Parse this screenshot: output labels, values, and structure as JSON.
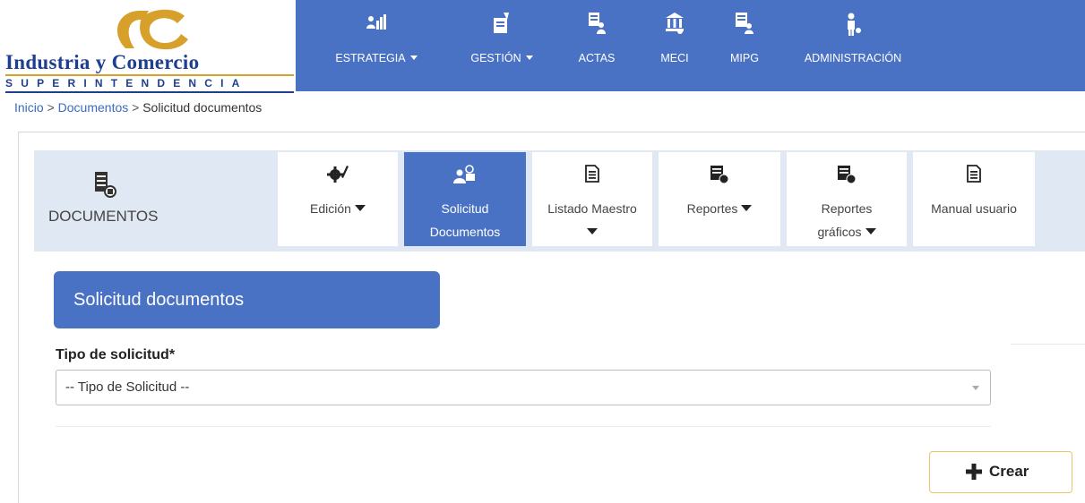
{
  "logo": {
    "line1": "Industria y Comercio",
    "line2": "SUPERINTENDENCIA"
  },
  "topnav": {
    "items": [
      {
        "label": "ESTRATEGIA",
        "icon": "people-chart-icon",
        "dropdown": true
      },
      {
        "label": "GESTIÓN",
        "icon": "document-edit-icon",
        "dropdown": true
      },
      {
        "label": "ACTAS",
        "icon": "meeting-document-icon",
        "dropdown": false
      },
      {
        "label": "MECI",
        "icon": "institution-icon",
        "dropdown": false
      },
      {
        "label": "MIPG",
        "icon": "document-person-icon",
        "dropdown": false
      },
      {
        "label": "ADMINISTRACIÓN",
        "icon": "admin-person-icon",
        "dropdown": false
      }
    ]
  },
  "breadcrumb": {
    "home": "Inicio",
    "separator": ">",
    "section": "Documentos",
    "current": "Solicitud documentos"
  },
  "module": {
    "title": "DOCUMENTOS",
    "icon": "documents-stack-icon",
    "tabs": [
      {
        "line1": "Edición",
        "line2": "",
        "icon": "gear-pencil-icon",
        "dropdown": true,
        "active": false
      },
      {
        "line1": "Solicitud",
        "line2": "Documentos",
        "icon": "request-person-icon",
        "dropdown": false,
        "active": true
      },
      {
        "line1": "Listado Maestro",
        "line2": "",
        "icon": "document-icon",
        "dropdown": true,
        "active": false
      },
      {
        "line1": "Reportes",
        "line2": "",
        "icon": "report-icon",
        "dropdown": true,
        "active": false
      },
      {
        "line1": "Reportes",
        "line2": "gráficos",
        "icon": "report-chart-icon",
        "dropdown": true,
        "active": false
      },
      {
        "line1": "Manual usuario",
        "line2": "",
        "icon": "manual-icon",
        "dropdown": false,
        "active": false
      }
    ]
  },
  "form": {
    "header": "Solicitud documentos",
    "field_label": "Tipo de solicitud*",
    "select_value": "-- Tipo de Solicitud --",
    "create_button": "Crear"
  },
  "colors": {
    "primary": "#4a72c4",
    "module_bar": "#dfe8f3",
    "button_border": "#e9c56a",
    "logo_blue": "#1e3f8f",
    "logo_gold": "#d6a02a"
  }
}
